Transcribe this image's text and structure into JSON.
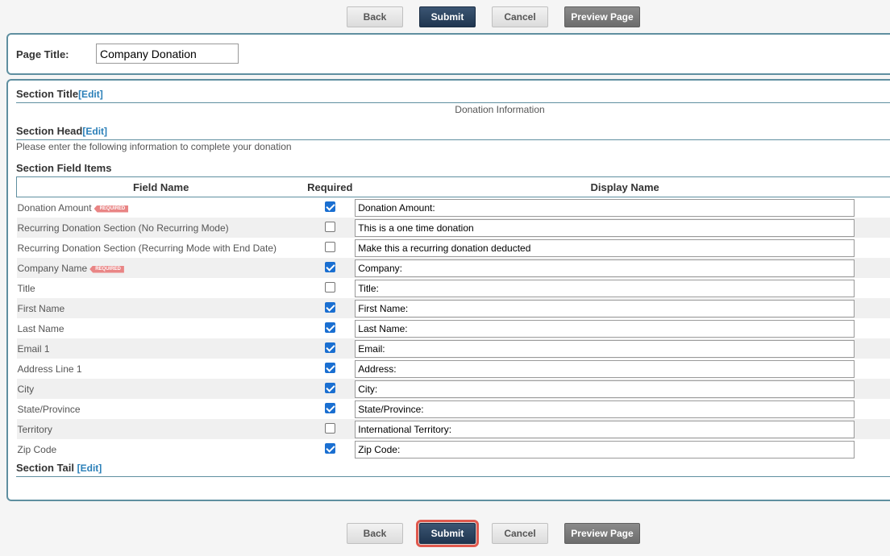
{
  "toolbar": {
    "back_label": "Back",
    "submit_label": "Submit",
    "cancel_label": "Cancel",
    "preview_label": "Preview Page"
  },
  "page_title": {
    "label": "Page Title:",
    "value": "Company Donation"
  },
  "section": {
    "title_label": "Section Title",
    "title_value": "Donation Information",
    "head_label": "Section Head",
    "head_value": "Please enter the following information to complete your donation",
    "field_items_label": "Section Field Items",
    "tail_label": "Section Tail",
    "edit_label": "[Edit]"
  },
  "table": {
    "columns": [
      "Field Name",
      "Required",
      "Display Name"
    ],
    "required_tag": "REQUIRED",
    "rows": [
      {
        "field": "Donation Amount",
        "tag": true,
        "required": true,
        "display": "Donation Amount:"
      },
      {
        "field": "Recurring Donation Section (No Recurring Mode)",
        "tag": false,
        "required": false,
        "display": "This is a one time donation"
      },
      {
        "field": "Recurring Donation Section (Recurring Mode with End Date)",
        "tag": false,
        "required": false,
        "display": "Make this a recurring donation deducted"
      },
      {
        "field": "Company Name",
        "tag": true,
        "required": true,
        "display": "Company:"
      },
      {
        "field": "Title",
        "tag": false,
        "required": false,
        "display": "Title:"
      },
      {
        "field": "First Name",
        "tag": false,
        "required": true,
        "display": "First Name:"
      },
      {
        "field": "Last Name",
        "tag": false,
        "required": true,
        "display": "Last Name:"
      },
      {
        "field": "Email 1",
        "tag": false,
        "required": true,
        "display": "Email:"
      },
      {
        "field": "Address Line 1",
        "tag": false,
        "required": true,
        "display": "Address:"
      },
      {
        "field": "City",
        "tag": false,
        "required": true,
        "display": "City:"
      },
      {
        "field": "State/Province",
        "tag": false,
        "required": true,
        "display": "State/Province:"
      },
      {
        "field": "Territory",
        "tag": false,
        "required": false,
        "display": "International Territory:"
      },
      {
        "field": "Zip Code",
        "tag": false,
        "required": true,
        "display": "Zip Code:"
      }
    ]
  },
  "colors": {
    "accent_border": "#5f8fa0",
    "submit_bg": "#1f3550",
    "link": "#2a7fb8",
    "highlight": "#e0594e"
  }
}
